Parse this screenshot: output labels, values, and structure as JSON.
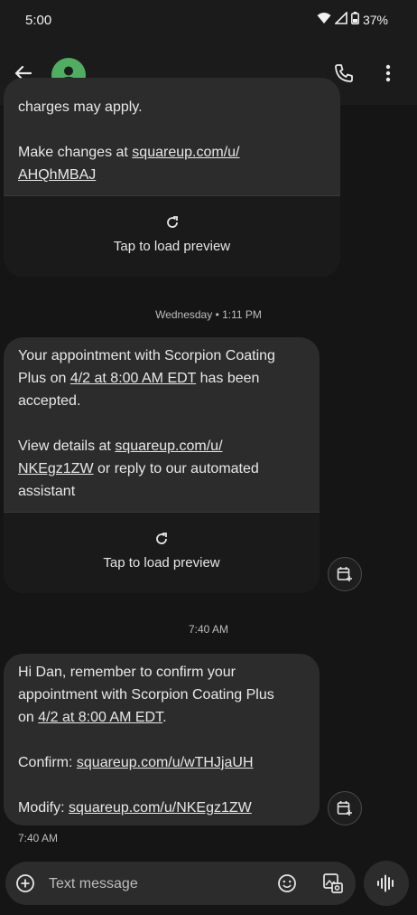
{
  "status_bar": {
    "time": "5:00",
    "battery": "37%",
    "icons": [
      "wifi-icon",
      "signal-icon",
      "battery-icon"
    ]
  },
  "app_bar": {
    "back_icon": "arrow-back-icon",
    "avatar_icon": "person-icon",
    "call_icon": "phone-icon",
    "menu_icon": "more-vert-icon",
    "avatar_color": "#4fae62"
  },
  "messages": [
    {
      "line1": "charges may apply.",
      "line2_prefix": "Make changes at ",
      "link_a": "squareup.com/u/",
      "link_b": "AHQhMBAJ",
      "preview_label": "Tap to load preview"
    },
    {
      "separator": "Wednesday • 1:11 PM",
      "l1": "Your appointment with Scorpion Coating",
      "l2_prefix": "Plus on ",
      "l2_link": "4/2 at 8:00 AM EDT",
      "l2_suffix": " has been",
      "l3": "accepted.",
      "l4_prefix": "View details at ",
      "l4_link": "squareup.com/u/",
      "l5_link": "NKEgz1ZW",
      "l5_suffix": " or reply to our automated",
      "l6": "assistant",
      "preview_label": "Tap to load preview"
    },
    {
      "separator": "7:40 AM",
      "l1": "Hi Dan, remember to confirm your",
      "l2": "appointment with Scorpion Coating Plus",
      "l3_prefix": "on ",
      "l3_link": "4/2 at 8:00 AM EDT",
      "l3_suffix": ".",
      "l4_prefix": "Confirm: ",
      "l4_link": "squareup.com/u/wTHJjaUH",
      "l5_prefix": "Modify: ",
      "l5_link": "squareup.com/u/NKEgz1ZW",
      "time": "7:40 AM"
    }
  ],
  "compose": {
    "placeholder": "Text message",
    "add_icon": "add-circle-icon",
    "emoji_icon": "emoji-icon",
    "gallery_icon": "gallery-icon",
    "voice_icon": "voice-waveform-icon"
  },
  "colors": {
    "background": "#151515",
    "bubble": "#2c2c2c",
    "accent_avatar": "#4fae62"
  }
}
